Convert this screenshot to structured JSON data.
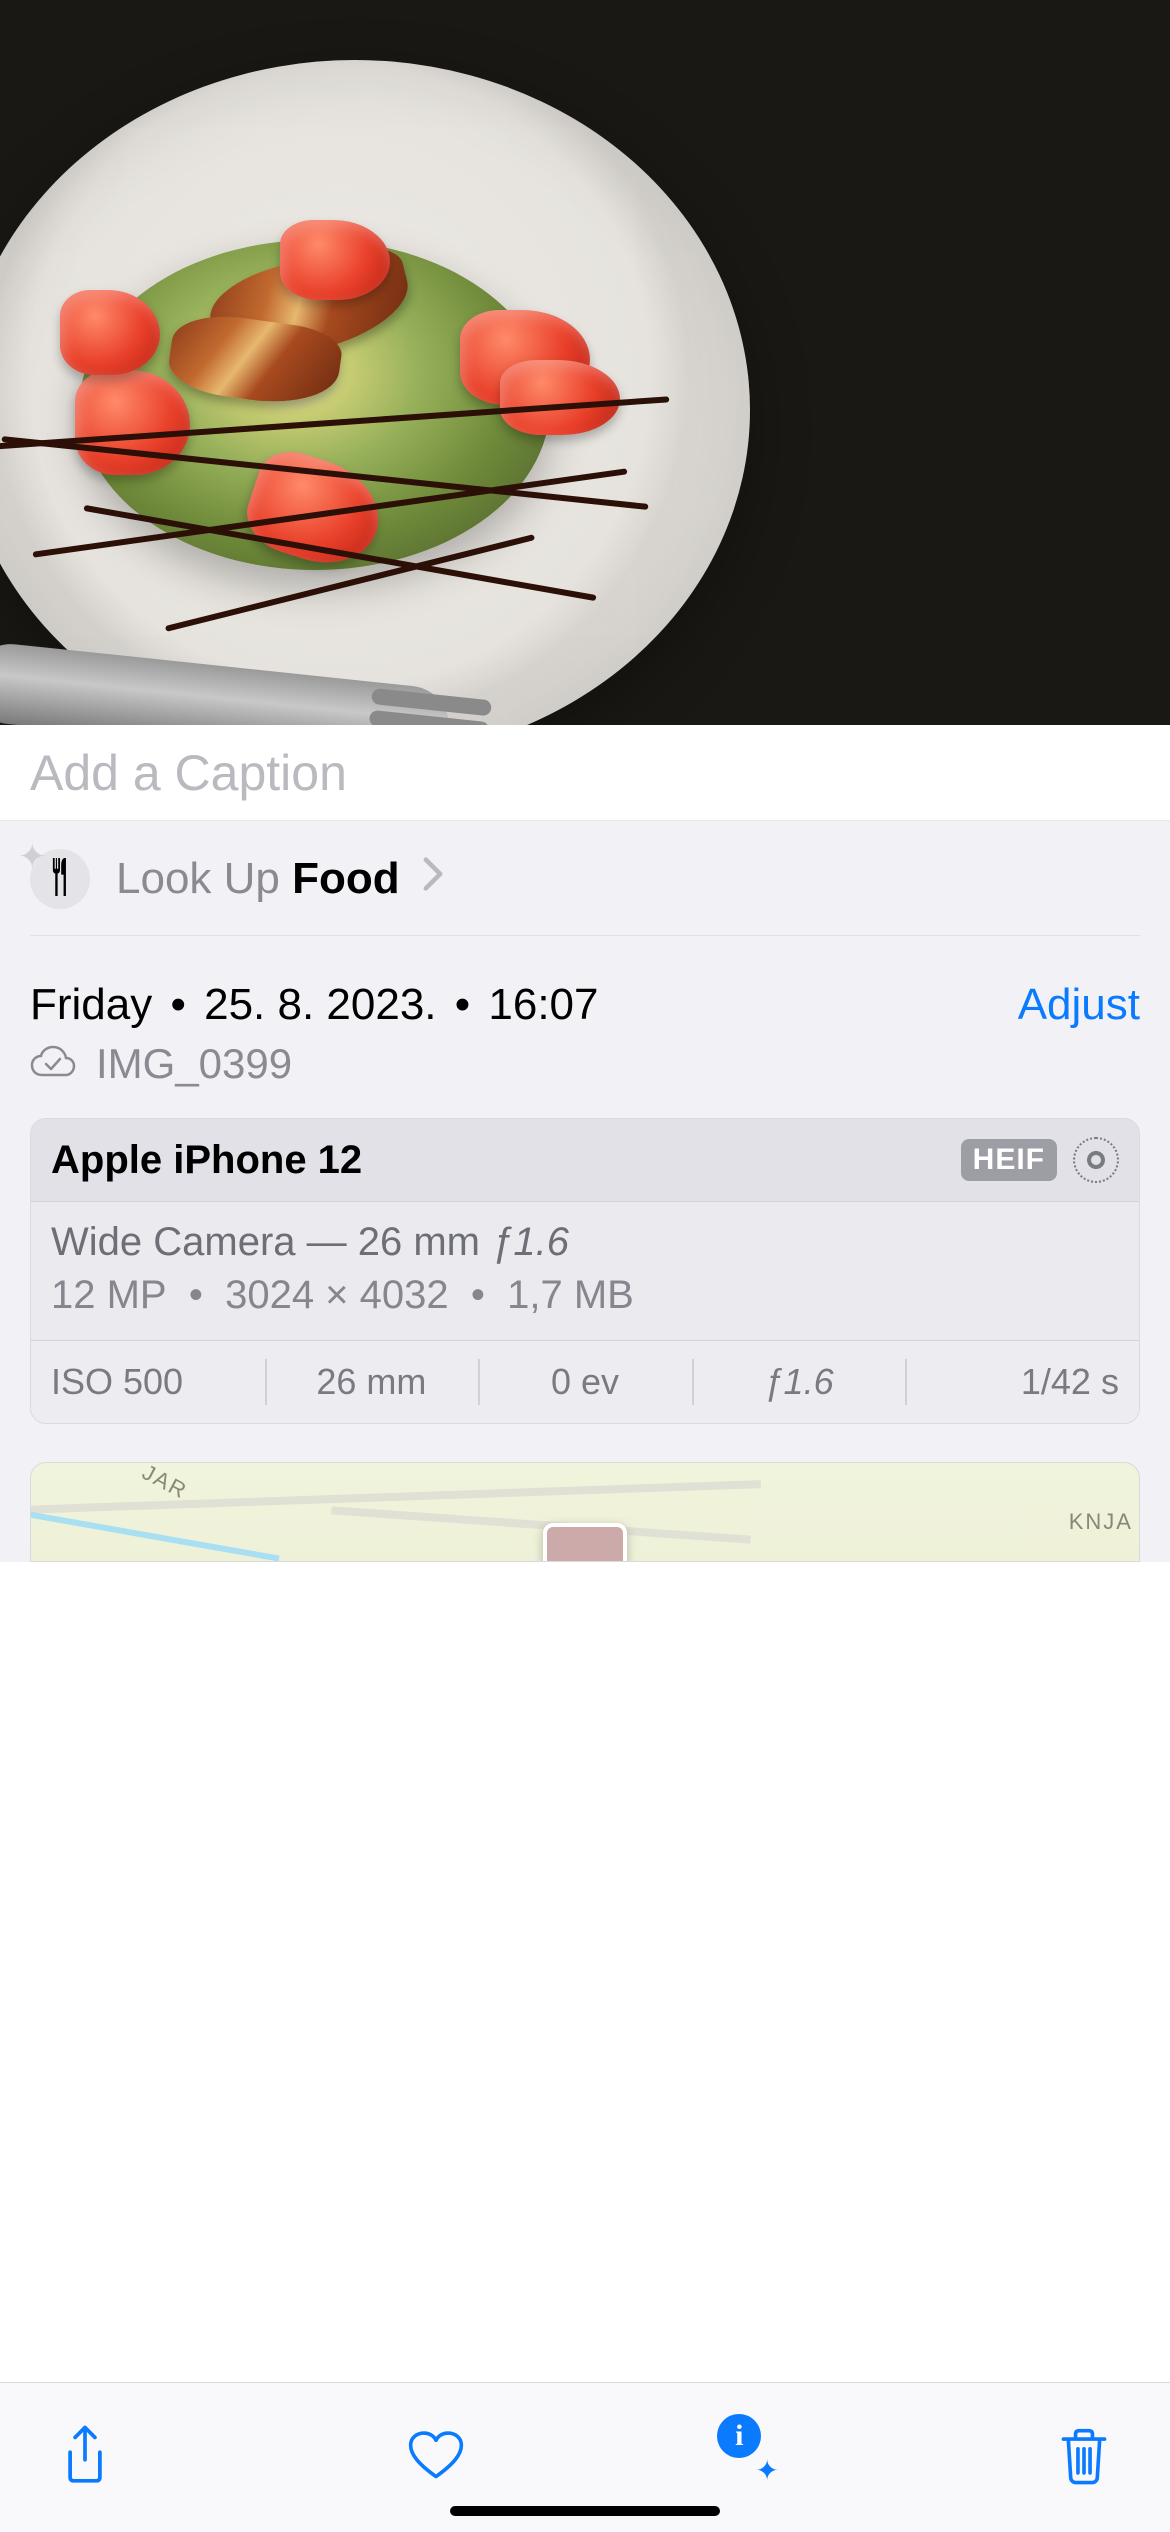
{
  "caption_placeholder": "Add a Caption",
  "lookup": {
    "prefix": "Look Up ",
    "subject": "Food"
  },
  "datetime": {
    "weekday": "Friday",
    "date": "25. 8. 2023.",
    "time": "16:07"
  },
  "adjust_label": "Adjust",
  "filename": "IMG_0399",
  "exif": {
    "device": "Apple iPhone 12",
    "format_badge": "HEIF",
    "lens_desc": "Wide Camera — 26 mm ",
    "lens_f": "ƒ1.6",
    "megapixels": "12 MP",
    "dimensions": "3024 × 4032",
    "filesize": "1,7 MB",
    "cells": {
      "iso": "ISO 500",
      "focal": "26 mm",
      "ev": "0 ev",
      "aperture": "ƒ1.6",
      "shutter": "1/42 s"
    }
  },
  "map": {
    "label1": "JAR",
    "label2": "KNJA"
  },
  "toolbar_info_glyph": "i"
}
